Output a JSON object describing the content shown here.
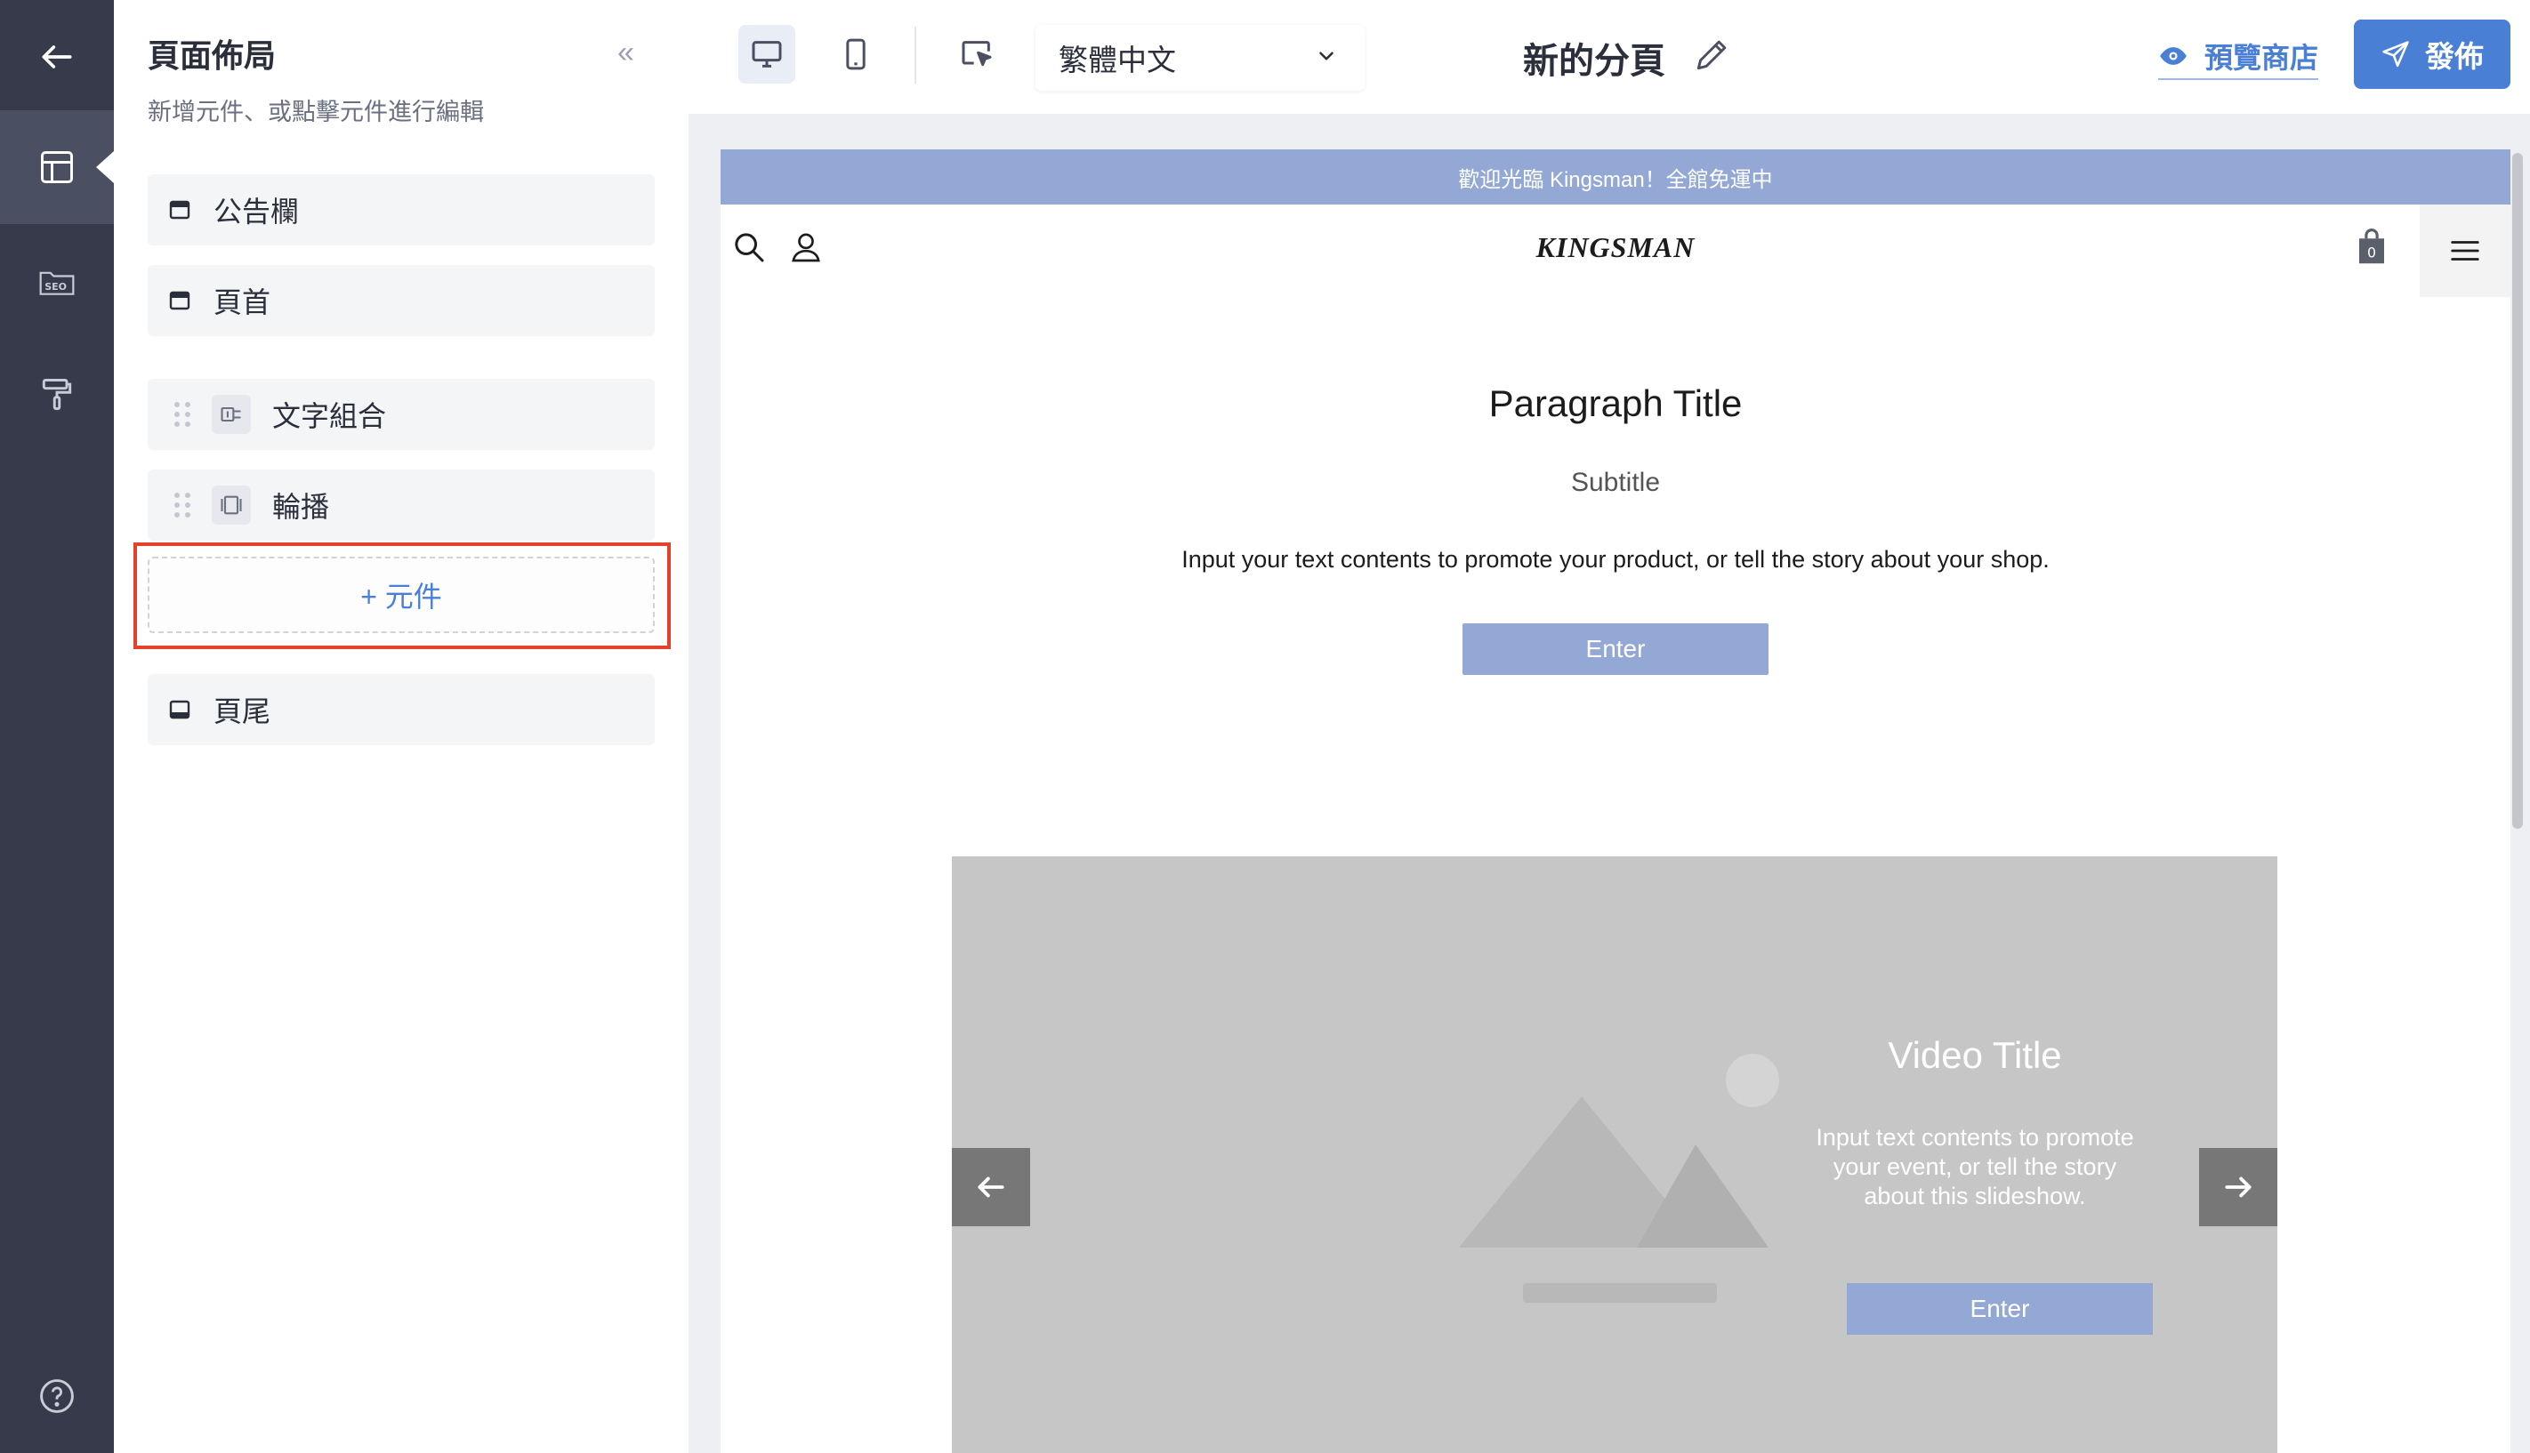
{
  "rail": {
    "items": [
      {
        "name": "back",
        "icon": "arrow-left-icon"
      },
      {
        "name": "layout",
        "icon": "layout-icon",
        "active": true
      },
      {
        "name": "seo",
        "icon": "seo-icon"
      },
      {
        "name": "theme",
        "icon": "paint-roller-icon"
      },
      {
        "name": "help",
        "icon": "help-circle-icon"
      }
    ]
  },
  "panel": {
    "title": "頁面佈局",
    "subtitle": "新增元件、或點擊元件進行編輯",
    "collapse_glyph": "«",
    "layers": [
      {
        "label": "公告欄",
        "icon": "window-icon",
        "draggable": false
      },
      {
        "label": "頁首",
        "icon": "window-icon",
        "draggable": false
      },
      {
        "label": "文字組合",
        "icon": "text-block-icon",
        "draggable": true
      },
      {
        "label": "輪播",
        "icon": "carousel-icon",
        "draggable": true
      }
    ],
    "add_label": "+ 元件",
    "footer_layer": {
      "label": "頁尾",
      "icon": "footer-icon"
    }
  },
  "topbar": {
    "language": "繁體中文",
    "page_name": "新的分頁",
    "preview_label": "預覽商店",
    "publish_label": "發佈"
  },
  "site": {
    "announcement": "歡迎光臨 Kingsman！全館免運中",
    "logo": "KINGSMAN",
    "cart_count": "0",
    "paragraph": {
      "title": "Paragraph Title",
      "subtitle": "Subtitle",
      "body": "Input your text contents to promote your product, or tell the story about your shop.",
      "button": "Enter"
    },
    "slideshow": {
      "title": "Video Title",
      "body": "Input text contents to promote your event, or tell the story about this slideshow.",
      "button": "Enter"
    }
  },
  "colors": {
    "rail": "#363a4a",
    "accent": "#4a7fd6",
    "highlight": "#e2432a",
    "site_accent": "#93a8d4"
  }
}
